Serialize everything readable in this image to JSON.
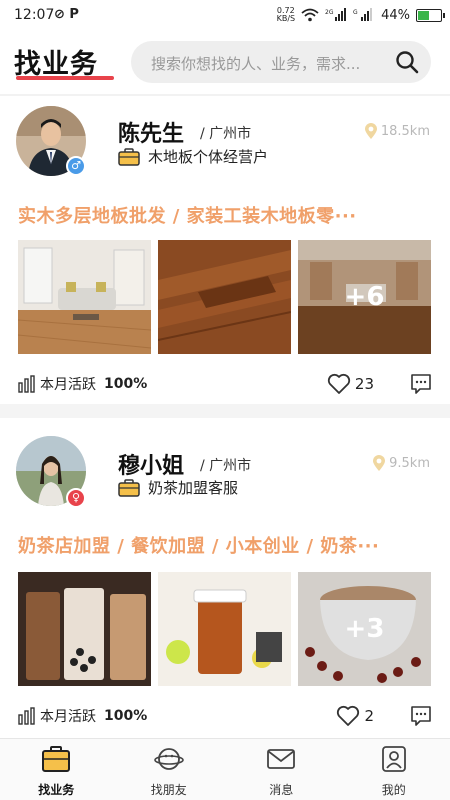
{
  "status_bar": {
    "time": "12:07",
    "left_icons": "⊘ P",
    "net_speed_value": "0.72",
    "net_speed_unit": "KB/S",
    "signal_1": "²⁶",
    "signal_2": "ᴳ",
    "battery": "44%"
  },
  "header": {
    "logo": "找业务",
    "search_placeholder": "搜索你想找的人、业务，需求..."
  },
  "cards": [
    {
      "name": "陈先生",
      "city": "/ 广州市",
      "distance": "18.5km",
      "business": "木地板个体经营户",
      "tags": "实木多层地板批发 / 家装工装木地板零···",
      "more_photos": "+6",
      "activity_label": "本月活跃",
      "activity_value": "100%",
      "likes": "23"
    },
    {
      "name": "穆小姐",
      "city": "/ 广州市",
      "distance": "9.5km",
      "business": "奶茶加盟客服",
      "tags": "奶茶店加盟 / 餐饮加盟 / 小本创业 / 奶茶···",
      "more_photos": "+3",
      "activity_label": "本月活跃",
      "activity_value": "100%",
      "likes": "2"
    }
  ],
  "bottom_nav": [
    {
      "label": "找业务",
      "icon": "briefcase-icon",
      "active": true
    },
    {
      "label": "找朋友",
      "icon": "planet-icon",
      "active": false
    },
    {
      "label": "消息",
      "icon": "mail-icon",
      "active": false
    },
    {
      "label": "我的",
      "icon": "person-icon",
      "active": false
    }
  ],
  "colors": {
    "accent_red": "#e8434b",
    "tag_orange": "#f0a06a",
    "gender_male": "#4a9be8",
    "gender_female": "#e8434b",
    "briefcase_gold": "#f5c04a"
  }
}
